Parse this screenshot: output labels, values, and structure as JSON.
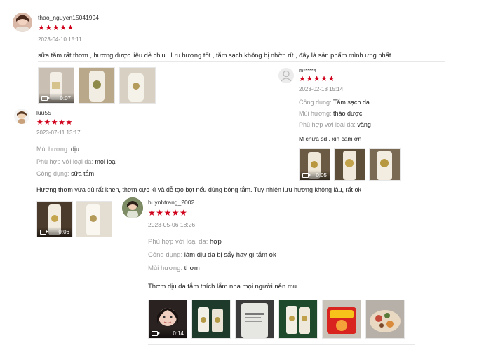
{
  "colors": {
    "star": "#d0011b",
    "meta": "#888888",
    "label": "#999999"
  },
  "reviews": [
    {
      "username": "thao_nguyen15041994",
      "stars": "★★★★★",
      "date": "2023-04-10 15:11",
      "text": "sữa tắm rất thơm , hương dược liệu dễ chịu , lưu hương tốt , tắm sạch không bị nhờn rít , đây là sản phẩm mình ưng nhất",
      "media": [
        {
          "kind": "video",
          "duration": "0:07"
        },
        {
          "kind": "image"
        },
        {
          "kind": "image"
        }
      ]
    },
    {
      "username": "m*****4",
      "stars": "★★★★★",
      "date": "2023-02-18 15:14",
      "attrs": [
        {
          "label": "Công dụng:",
          "value": "Tắm sạch da"
        },
        {
          "label": "Mùi hương:",
          "value": "thảo dược"
        },
        {
          "label": "Phù hợp với loại da:",
          "value": "vãng"
        }
      ],
      "text": "M chưa sd , xin cảm ơn",
      "media": [
        {
          "kind": "video",
          "duration": "0:05"
        },
        {
          "kind": "image"
        },
        {
          "kind": "image"
        }
      ]
    },
    {
      "username": "luu55",
      "stars": "★★★★★",
      "date": "2023-07-11 13:17",
      "attrs": [
        {
          "label": "Mùi hương:",
          "value": "dịu"
        },
        {
          "label": "Phù hợp với loại da:",
          "value": "mọi loại"
        },
        {
          "label": "Công dụng:",
          "value": "sữa tắm"
        }
      ],
      "text": "Hương thơm vừa đủ rất khen, thơm cực kì và dễ tạo bọt nếu dùng bông tắm. Tuy nhiên lưu hương không lâu, rất ok",
      "media": [
        {
          "kind": "video",
          "duration": "0:06"
        },
        {
          "kind": "image"
        }
      ]
    },
    {
      "username": "huynhtrang_2002",
      "stars": "★★★★★",
      "date": "2023-05-06 18:26",
      "attrs": [
        {
          "label": "Phù hợp với loại da:",
          "value": "hợp"
        },
        {
          "label": "Công dụng:",
          "value": "làm dịu da bị sẩy hay gì tắm ok"
        },
        {
          "label": "Mùi hương:",
          "value": "thơm"
        }
      ],
      "text": "Thơm dịu da tắm thích lắm nha mọi người nên mu",
      "media": [
        {
          "kind": "video",
          "duration": "0:14"
        },
        {
          "kind": "image"
        },
        {
          "kind": "image"
        },
        {
          "kind": "image"
        },
        {
          "kind": "image"
        },
        {
          "kind": "image"
        }
      ]
    }
  ]
}
